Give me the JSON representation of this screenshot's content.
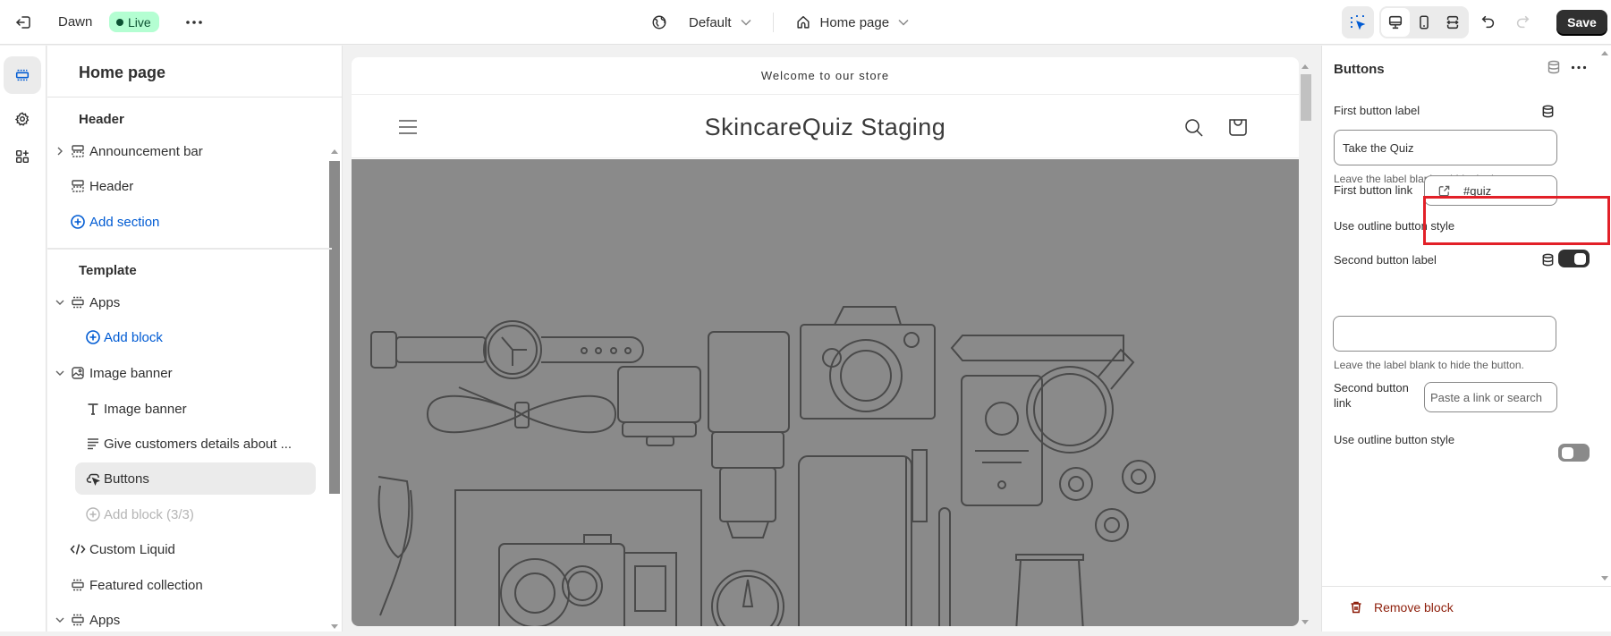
{
  "topbar": {
    "exit_icon": "exit-icon",
    "theme_name": "Dawn",
    "status_badge": "Live",
    "more_icon": "ellipsis-icon",
    "context_selector": "Default",
    "page_selector": "Home page",
    "save_label": "Save",
    "tools": [
      "inspector-icon",
      "desktop-icon",
      "mobile-icon",
      "fullwidth-icon",
      "undo-icon",
      "redo-icon"
    ]
  },
  "rail": {
    "items": [
      {
        "icon": "sections-icon",
        "active": true
      },
      {
        "icon": "settings-icon",
        "active": false
      },
      {
        "icon": "apps-icon",
        "active": false
      }
    ]
  },
  "left_panel": {
    "title": "Home page",
    "header_group": {
      "heading": "Header",
      "items": [
        {
          "label": "Announcement bar",
          "icon": "section-icon",
          "expandable": true
        },
        {
          "label": "Header",
          "icon": "section-icon",
          "expandable": false
        }
      ],
      "add_label": "Add section"
    },
    "template_group": {
      "heading": "Template",
      "items": [
        {
          "label": "Apps",
          "icon": "section-icon",
          "expanded": true
        },
        {
          "label": "Add block",
          "type": "add"
        },
        {
          "label": "Image banner",
          "icon": "image-icon",
          "expanded": true
        },
        {
          "label": "Image banner",
          "icon": "text-icon",
          "type": "block"
        },
        {
          "label": "Give customers details about ...",
          "icon": "paragraph-icon",
          "type": "block"
        },
        {
          "label": "Buttons",
          "icon": "button-icon",
          "type": "block",
          "selected": true
        },
        {
          "label": "Add block (3/3)",
          "type": "add-disabled"
        },
        {
          "label": "Custom Liquid",
          "icon": "code-icon"
        },
        {
          "label": "Featured collection",
          "icon": "section-icon"
        },
        {
          "label": "Apps",
          "icon": "section-icon",
          "expanded": true
        }
      ]
    }
  },
  "preview": {
    "announcement": "Welcome to our store",
    "store_name": "SkincareQuiz Staging",
    "hero_image": "travel-items-illustration"
  },
  "right_panel": {
    "title": "Buttons",
    "first_label": {
      "label": "First button label",
      "value": "Take the Quiz",
      "help": "Leave the label blank to hide the button."
    },
    "first_link": {
      "label": "First button link",
      "value": "#quiz"
    },
    "first_outline": {
      "label": "Use outline button style",
      "on": true
    },
    "second_label": {
      "label": "Second button label",
      "value": "",
      "help": "Leave the label blank to hide the button."
    },
    "second_link": {
      "label_line1": "Second button",
      "label_line2": "link",
      "placeholder": "Paste a link or search"
    },
    "second_outline": {
      "label": "Use outline button style",
      "on": false
    },
    "remove_label": "Remove block"
  },
  "colors": {
    "live_badge_bg": "#b4fed2",
    "link_blue": "#005bd3",
    "remove_red": "#8e1f0b",
    "highlight_red": "#e22028",
    "save_bg": "#303030"
  }
}
